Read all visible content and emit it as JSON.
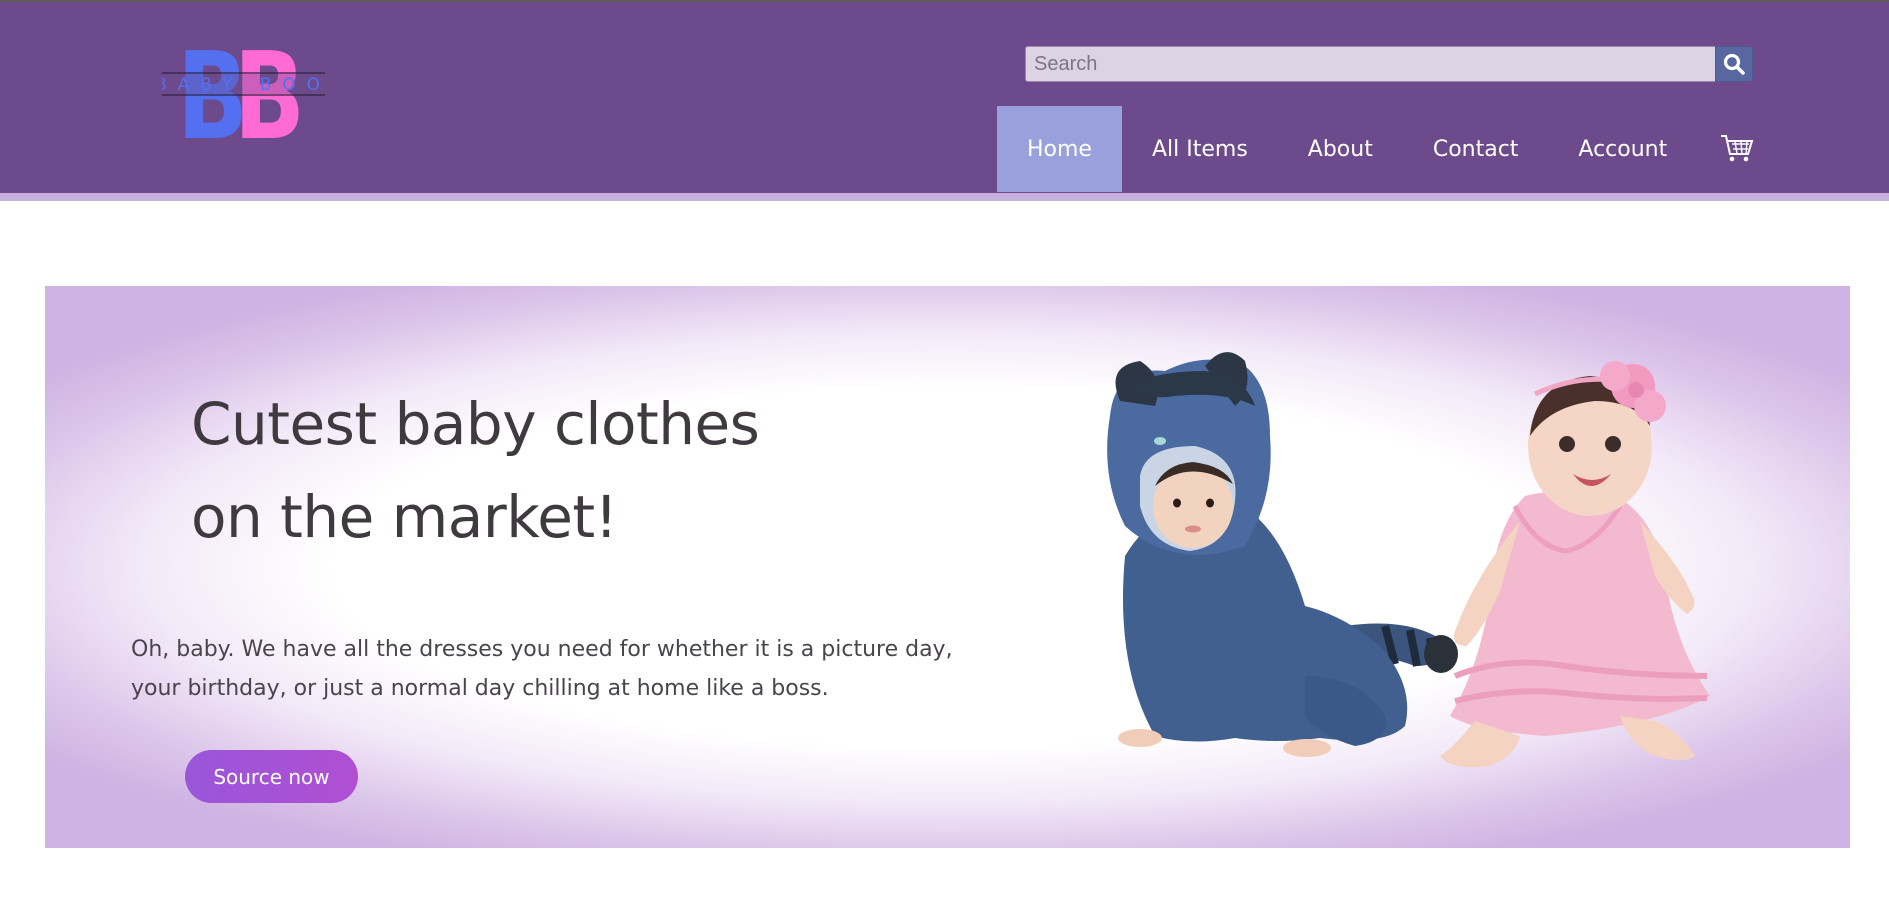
{
  "brand": {
    "name": "BABY BOO",
    "letters": "BB",
    "colors": {
      "blue": "#5470f0",
      "pink": "#ff6ad5"
    }
  },
  "search": {
    "placeholder": "Search",
    "value": "",
    "icon": "search-icon"
  },
  "nav": {
    "items": [
      {
        "label": "Home",
        "active": true
      },
      {
        "label": "All Items",
        "active": false
      },
      {
        "label": "About",
        "active": false
      },
      {
        "label": "Contact",
        "active": false
      },
      {
        "label": "Account",
        "active": false
      }
    ],
    "cart_icon": "shopping-cart-icon"
  },
  "hero": {
    "title_line1": "Cutest baby clothes",
    "title_line2": "on the market!",
    "text_line1": "Oh, baby. We have all the dresses you need for whether it is a picture day,",
    "text_line2": "your birthday, or just a normal day chilling at home like a boss.",
    "cta_label": "Source now",
    "image": "babies-photo"
  },
  "colors": {
    "header": "#6c4a8b",
    "nav_active": "#9aa0dc",
    "accent": "#a352d6",
    "hero_edge": "#cfb3e3"
  }
}
